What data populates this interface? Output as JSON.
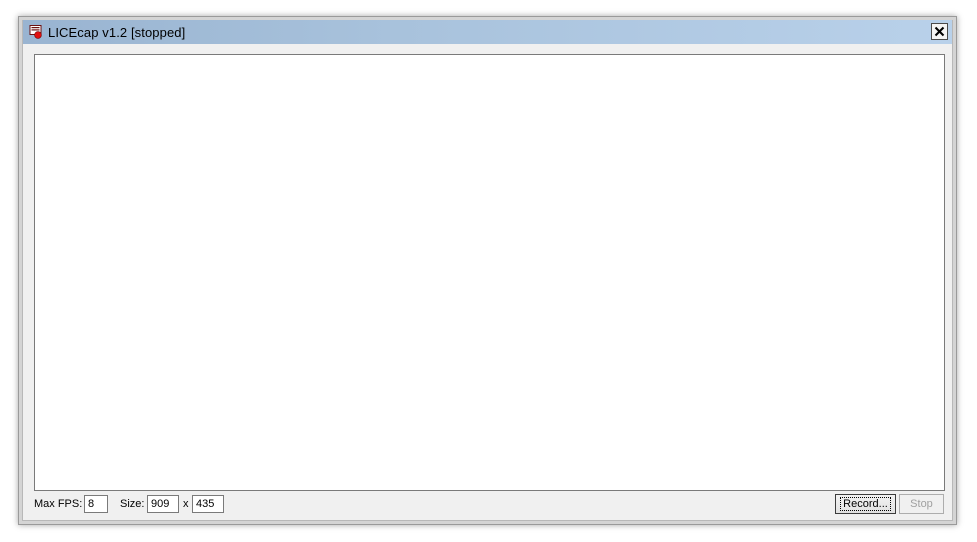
{
  "window": {
    "title": "LICEcap v1.2 [stopped]",
    "app_icon": "licecap-icon",
    "close_icon": "close-icon"
  },
  "controls": {
    "max_fps_label": "Max FPS:",
    "max_fps_value": "8",
    "size_label": "Size:",
    "size_width_value": "909",
    "size_separator": "x",
    "size_height_value": "435",
    "record_label": "Record...",
    "stop_label": "Stop"
  },
  "colors": {
    "titlebar_start": "#99b4d1",
    "titlebar_end": "#b9d1ea",
    "disabled_text": "#a0a0a0"
  }
}
